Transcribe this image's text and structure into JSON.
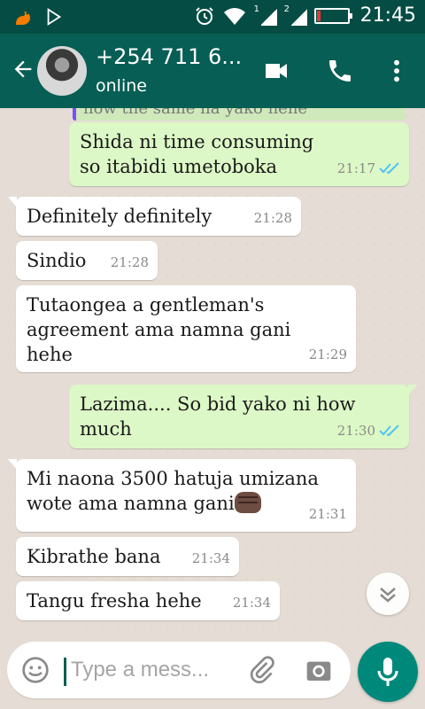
{
  "status_bar": {
    "time": "21:45",
    "sim1_label": "1",
    "sim2_label": "2",
    "battery_level": 0.12,
    "icons": [
      "squirrel-app-icon",
      "play-store-icon",
      "alarm-icon",
      "wifi-icon",
      "signal-icon",
      "battery-icon"
    ]
  },
  "header": {
    "contact_name": "+254 711 6...",
    "contact_status": "online",
    "icons": [
      "back-arrow-icon",
      "avatar",
      "video-call-icon",
      "phone-icon",
      "more-vertical-icon"
    ]
  },
  "chat": {
    "quoted_snippet": "how the same na yako hehe",
    "messages": [
      {
        "direction": "out",
        "text": "Shida ni time consuming so itabidi umetoboka",
        "time": "21:17",
        "read": true
      },
      {
        "direction": "in",
        "text": "Definitely definitely",
        "time": "21:28"
      },
      {
        "direction": "in",
        "text": "Sindio",
        "time": "21:28"
      },
      {
        "direction": "in",
        "text": "Tutaongea a gentleman's agreement ama namna gani hehe",
        "time": "21:29"
      },
      {
        "direction": "out",
        "text": "Lazima.... So bid yako ni how much",
        "time": "21:30",
        "read": true
      },
      {
        "direction": "in",
        "text": "Mi naona 3500 hatuja umizana wote  ama namna gani",
        "time": "21:31",
        "emoji": "fist-icon"
      },
      {
        "direction": "in",
        "text": "Kibrathe bana",
        "time": "21:34"
      },
      {
        "direction": "in",
        "text": "Tangu fresha hehe",
        "time": "21:34"
      }
    ]
  },
  "input": {
    "placeholder": "Type a mess..."
  },
  "colors": {
    "status_bar": "#054d44",
    "header": "#075e54",
    "outgoing_bubble": "#dcf8c6",
    "incoming_bubble": "#ffffff",
    "mic_button": "#00897b",
    "read_ticks": "#4fc3f7"
  }
}
